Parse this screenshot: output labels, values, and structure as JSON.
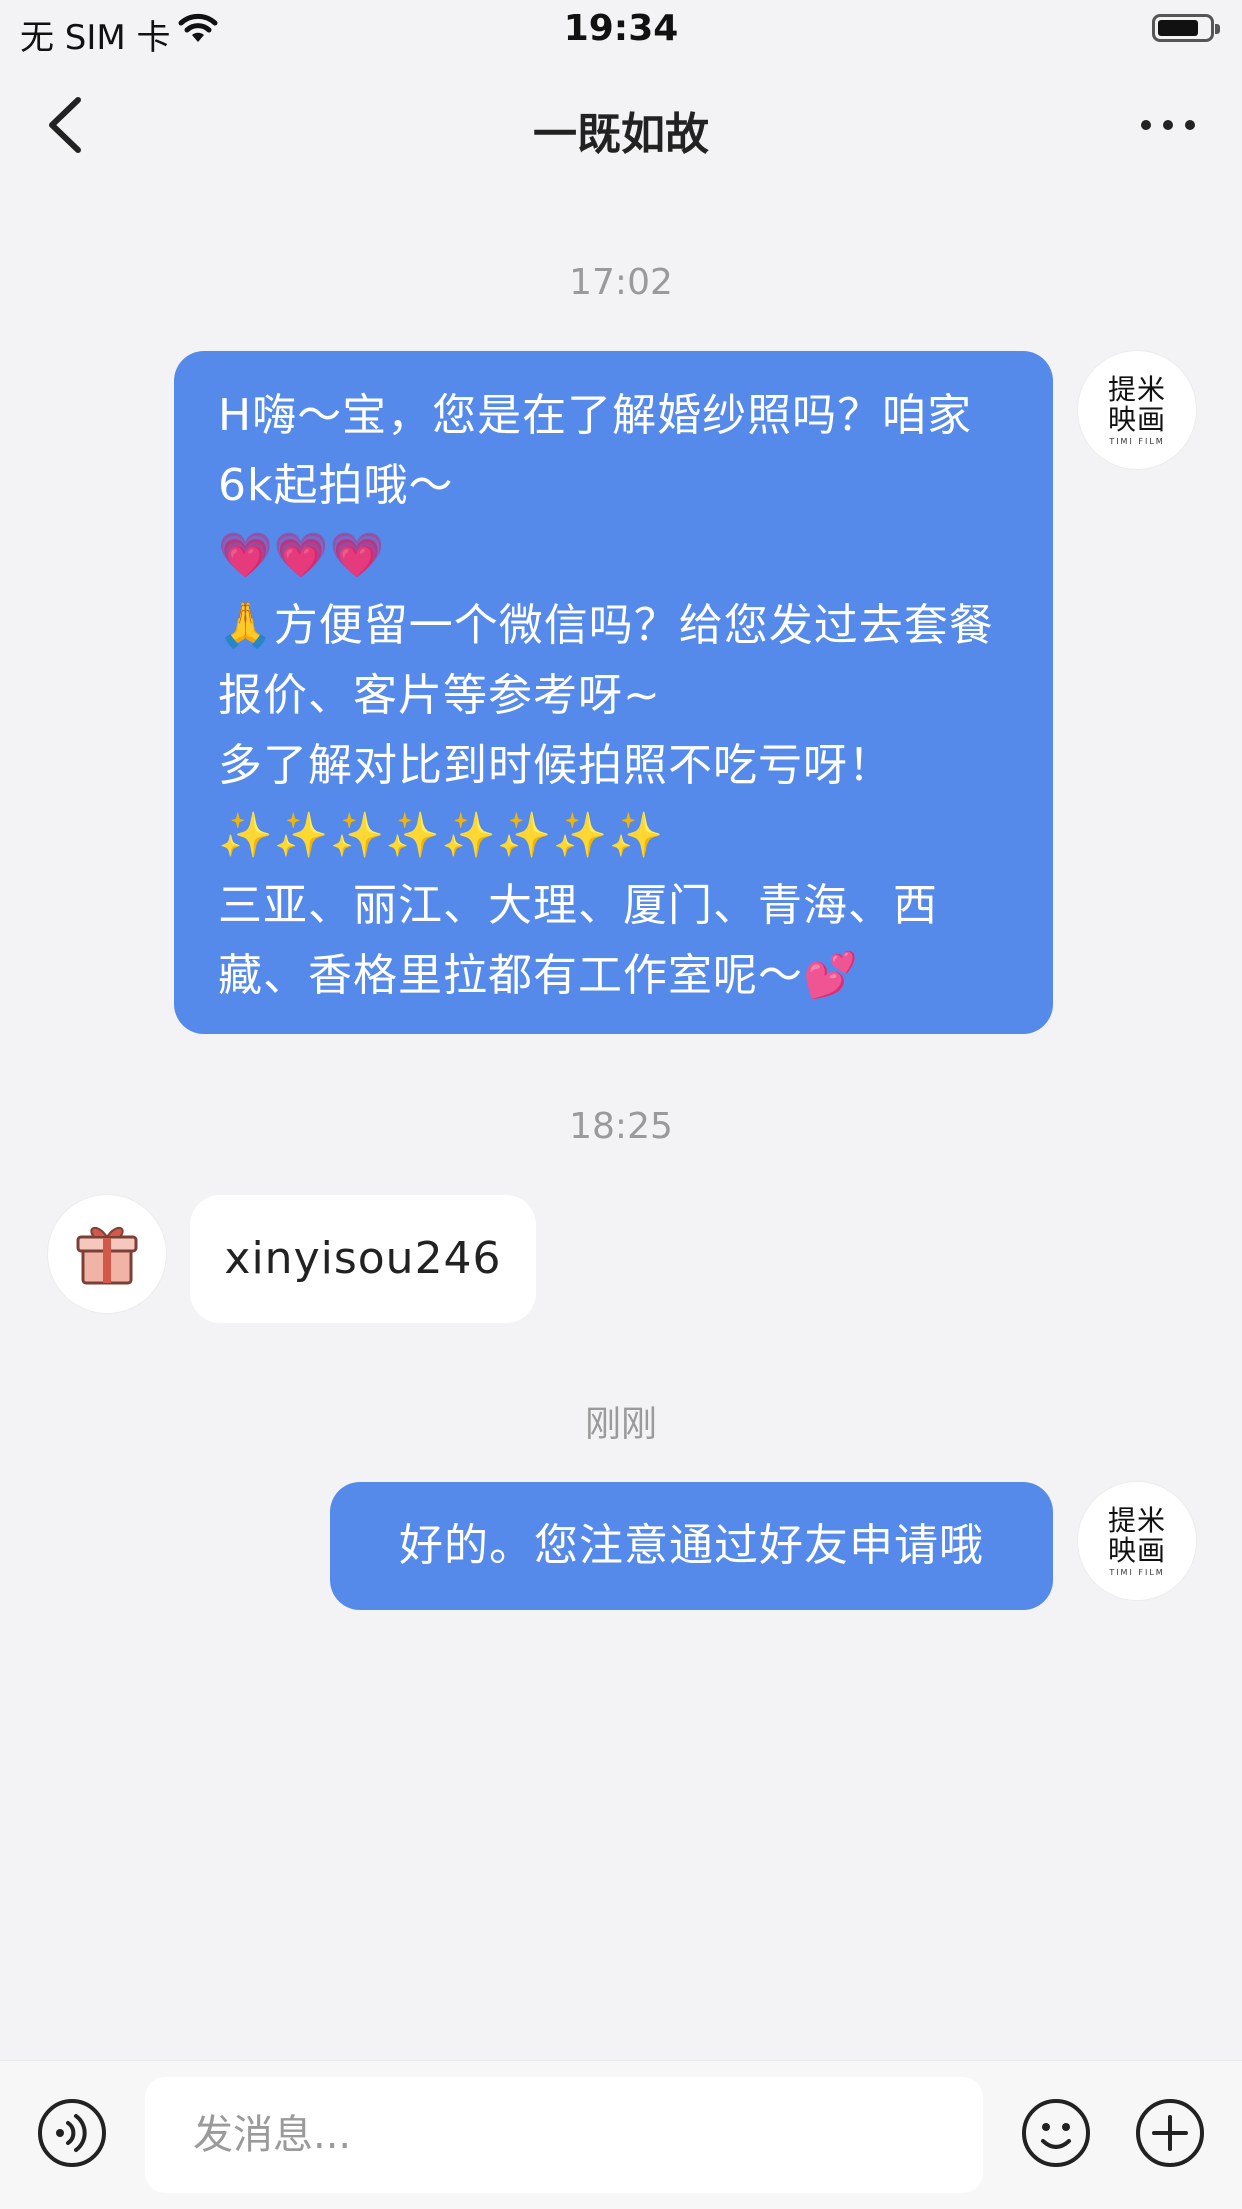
{
  "status_bar": {
    "carrier": "无 SIM 卡",
    "time": "19:34"
  },
  "nav": {
    "title": "一既如故",
    "back_icon": "chevron-left-icon",
    "more_icon": "ellipsis-icon"
  },
  "brand_avatar": {
    "line1": "提米",
    "line2": "映画",
    "small": "TIMI FILM"
  },
  "messages": [
    {
      "time": "17:02",
      "direction": "outgoing",
      "text": "H嗨～宝，您是在了解婚纱照吗？咱家6k起拍哦～\n💗💗💗\n🙏方便留一个微信吗？给您发过去套餐报价、客片等参考呀~\n多了解对比到时候拍照不吃亏呀！\n✨✨✨✨✨✨✨✨\n三亚、丽江、大理、厦门、青海、西藏、香格里拉都有工作室呢～💕"
    },
    {
      "time": "18:25",
      "direction": "incoming",
      "avatar_icon": "gift-icon",
      "text": "xinyisou246"
    },
    {
      "time": "刚刚",
      "direction": "outgoing",
      "text": "好的。您注意通过好友申请哦"
    }
  ],
  "input_bar": {
    "placeholder": "发消息...",
    "voice_icon": "voice-icon",
    "emoji_icon": "emoji-icon",
    "plus_icon": "plus-icon"
  },
  "colors": {
    "bubble_out": "#5589ea",
    "bubble_in": "#ffffff",
    "background": "#f3f3f5",
    "timestamp": "#9a9a9a"
  }
}
